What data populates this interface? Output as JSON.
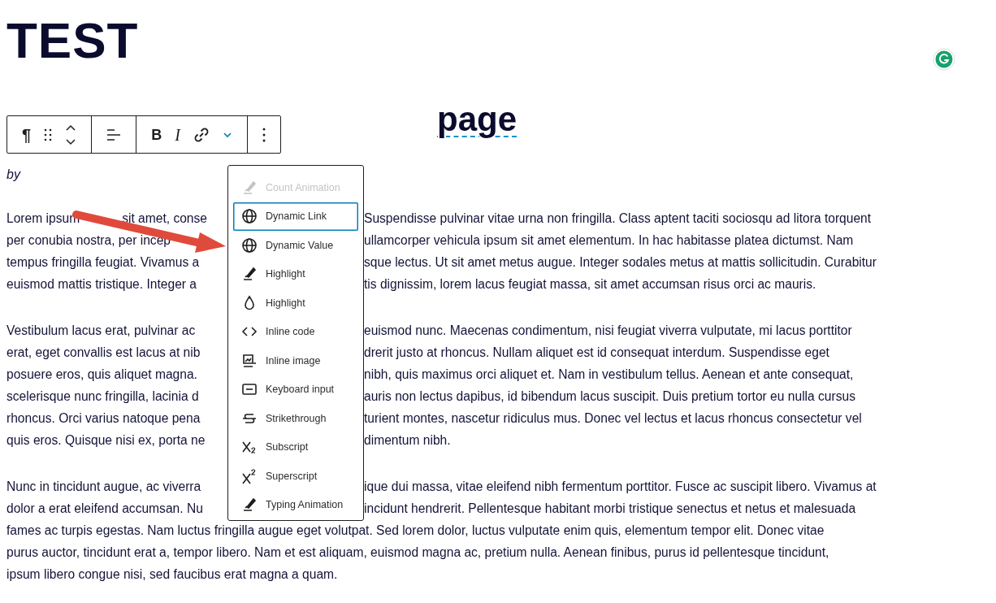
{
  "title": "TEST",
  "heading": {
    "text": "page",
    "spelling_flag": true
  },
  "toolbar": {
    "groups": [
      [
        {
          "kind": "paragraph",
          "label": "¶"
        },
        {
          "kind": "drag"
        },
        {
          "kind": "move"
        }
      ],
      [
        {
          "kind": "align"
        }
      ],
      [
        {
          "kind": "bold",
          "label": "B"
        },
        {
          "kind": "italic",
          "label": "I"
        },
        {
          "kind": "link"
        },
        {
          "kind": "caret",
          "expanded": true
        }
      ],
      [
        {
          "kind": "options"
        }
      ]
    ]
  },
  "byline": "by",
  "menu": {
    "items": [
      {
        "label": "Count Animation",
        "kind": "brush",
        "disabled": true,
        "focused": false
      },
      {
        "label": "Dynamic Link",
        "kind": "globe",
        "disabled": false,
        "focused": true
      },
      {
        "label": "Dynamic Value",
        "kind": "globe",
        "disabled": false,
        "focused": false
      },
      {
        "label": "Highlight",
        "kind": "brush",
        "disabled": false,
        "focused": false
      },
      {
        "label": "Highlight",
        "kind": "drop",
        "disabled": false,
        "focused": false
      },
      {
        "label": "Inline code",
        "kind": "code",
        "disabled": false,
        "focused": false
      },
      {
        "label": "Inline image",
        "kind": "image",
        "disabled": false,
        "focused": false
      },
      {
        "label": "Keyboard input",
        "kind": "keyboard",
        "disabled": false,
        "focused": false
      },
      {
        "label": "Strikethrough",
        "kind": "strike",
        "disabled": false,
        "focused": false
      },
      {
        "label": "Subscript",
        "kind": "subscript",
        "disabled": false,
        "focused": false
      },
      {
        "label": "Superscript",
        "kind": "superscript",
        "disabled": false,
        "focused": false
      },
      {
        "label": "Typing Animation",
        "kind": "brush",
        "disabled": false,
        "focused": false
      }
    ]
  },
  "paragraphs": [
    {
      "lines": [
        {
          "left_parts": [
            "Lorem ipsum",
            "sit amet, conse"
          ],
          "right": "Suspendisse pulvinar vitae urna non fringilla. Class aptent taciti sociosqu ad litora torquent"
        },
        {
          "left": "per conubia nostra, per incep",
          "right": "ullamcorper vehicula ipsum sit amet elementum. In hac habitasse platea dictumst. Nam"
        },
        {
          "left": "tempus fringilla feugiat. Vivamus a",
          "right": "sque lectus. Ut sit amet metus augue. Integer sodales metus at mattis sollicitudin. Curabitur"
        },
        {
          "left": "euismod mattis tristique. Integer a",
          "right": "tis dignissim, lorem lacus feugiat massa, sit amet accumsan risus orci ac mauris."
        }
      ]
    },
    {
      "lines": [
        {
          "left": "Vestibulum lacus erat, pulvinar ac",
          "right": "euismod nunc. Maecenas condimentum, nisi feugiat viverra vulputate, mi lacus porttitor"
        },
        {
          "left": "erat, eget convallis est lacus at nib",
          "right": "drerit justo at rhoncus. Nullam aliquet est id consequat interdum. Suspendisse eget"
        },
        {
          "left": "posuere eros, quis aliquet magna.",
          "right": "nibh, quis maximus orci aliquet et. Nam in vestibulum tellus. Aenean et ante consequat,"
        },
        {
          "left": "scelerisque nunc fringilla, lacinia d",
          "right": "auris non lectus dapibus, id bibendum lacus suscipit. Duis pretium tortor eu nulla cursus"
        },
        {
          "left": "rhoncus. Orci varius natoque pena",
          "right": "turient montes, nascetur ridiculus mus. Donec vel lectus et lacus rhoncus consectetur vel"
        },
        {
          "left": "quis eros. Quisque nisi ex, porta ne",
          "right": "dimentum nibh."
        }
      ]
    },
    {
      "lines": [
        {
          "left": "Nunc in tincidunt augue, ac viverra",
          "right": "ique dui massa, vitae eleifend nibh fermentum porttitor. Fusce ac suscipit libero. Vivamus at"
        },
        {
          "left": "dolor a erat eleifend accumsan. Nu",
          "right": "incidunt hendrerit. Pellentesque habitant morbi tristique senectus et netus et malesuada"
        },
        {
          "text": "fames ac turpis egestas. Nam luctus fringilla augue eget volutpat. Sed lorem dolor, luctus vulputate enim quis, elementum tempor elit. Donec vitae"
        },
        {
          "text": "purus auctor, tincidunt erat a, tempor libero. Nam et est aliquam, euismod magna ac, pretium nulla. Aenean finibus, purus id pellentesque tincidunt,"
        },
        {
          "text": "ipsum libero congue nisi, sed faucibus erat magna a quam."
        }
      ]
    }
  ]
}
